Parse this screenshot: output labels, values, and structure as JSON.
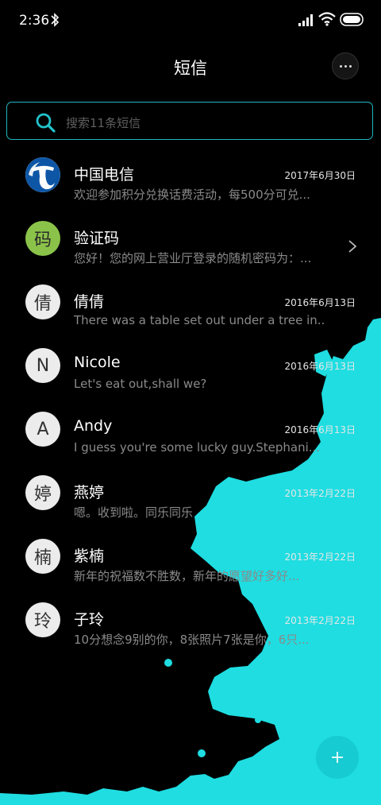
{
  "status": {
    "time": "2:36",
    "icons": [
      "bluetooth-icon",
      "signal-icon",
      "wifi-icon",
      "battery-icon"
    ]
  },
  "header": {
    "title": "短信",
    "more_icon": "more-dots-icon"
  },
  "search": {
    "placeholder": "搜索11条短信",
    "icon": "search-icon"
  },
  "messages": [
    {
      "name": "中国电信",
      "preview": "欢迎参加积分兑换话费活动，每500分可兑...",
      "date": "2017年6月30日",
      "avatar": "",
      "avatar_type": "logo"
    },
    {
      "name": "验证码",
      "preview": "您好！您的网上营业厅登录的随机密码为：...",
      "date": "",
      "avatar": "码",
      "avatar_type": "green"
    },
    {
      "name": "倩倩",
      "preview": "There was a table set out under a tree in...",
      "date": "2016年6月13日",
      "avatar": "倩",
      "avatar_type": "letter"
    },
    {
      "name": "Nicole",
      "preview": "Let's eat out,shall we?",
      "date": "2016年6月13日",
      "avatar": "N",
      "avatar_type": "letter"
    },
    {
      "name": "Andy",
      "preview": "I guess you're some lucky guy.Stephani...",
      "date": "2016年6月13日",
      "avatar": "A",
      "avatar_type": "letter"
    },
    {
      "name": "燕婷",
      "preview": "嗯。收到啦。同乐同乐",
      "date": "2013年2月22日",
      "avatar": "婷",
      "avatar_type": "letter"
    },
    {
      "name": "紫楠",
      "preview": "新年的祝福数不胜数，新年的愿望好多好...",
      "date": "2013年2月22日",
      "avatar": "楠",
      "avatar_type": "letter"
    },
    {
      "name": "子玲",
      "preview": "10分想念9别的你，8张照片7张是你，6只...",
      "date": "2013年2月22日",
      "avatar": "玲",
      "avatar_type": "letter"
    }
  ],
  "fab": {
    "icon": "plus-icon"
  },
  "colors": {
    "accent": "#1fdde1",
    "background": "#000000"
  }
}
